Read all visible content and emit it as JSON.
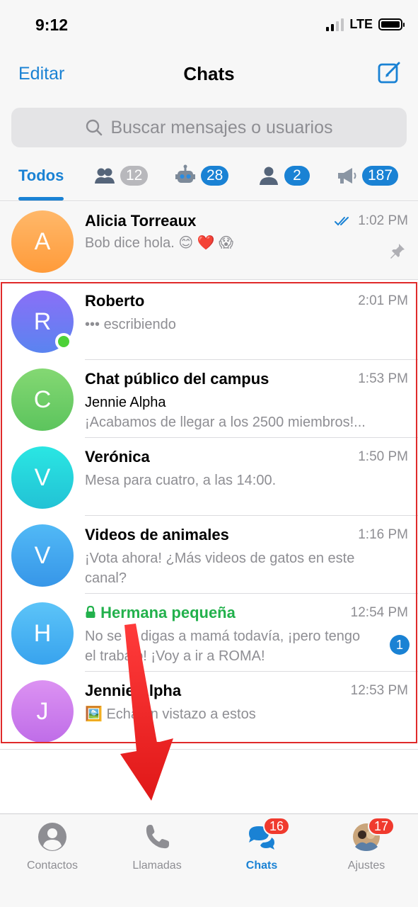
{
  "status_bar": {
    "time": "9:12",
    "network": "LTE"
  },
  "nav": {
    "edit_label": "Editar",
    "title": "Chats"
  },
  "search": {
    "placeholder": "Buscar mensajes o usuarios"
  },
  "tabs": [
    {
      "label": "Todos",
      "icon": "none",
      "active": true
    },
    {
      "icon": "groups-icon",
      "count": "12",
      "badge_style": "grey"
    },
    {
      "icon": "bot-icon",
      "count": "28",
      "badge_style": "blue"
    },
    {
      "icon": "person-icon",
      "count": "2",
      "badge_style": "blue"
    },
    {
      "icon": "megaphone-icon",
      "count": "187",
      "badge_style": "blue"
    }
  ],
  "chats": [
    {
      "initial": "A",
      "name": "Alicia Torreaux",
      "time": "1:02 PM",
      "preview": "Bob dice hola. 😊 ❤️ 😱",
      "pinned": true,
      "read": true,
      "color_from": "#ffb35c",
      "color_to": "#ff9f3e"
    },
    {
      "initial": "R",
      "name": "Roberto",
      "time": "2:01 PM",
      "preview": "••• escribiendo",
      "online": true,
      "color_from": "#7b6cf6",
      "color_to": "#5e7ef0"
    },
    {
      "initial": "C",
      "name": "Chat público del campus",
      "time": "1:53 PM",
      "sender": "Jennie Alpha",
      "preview": "¡Acabamos de llegar a los 2500 miembros!...",
      "color_from": "#7ad46c",
      "color_to": "#58c25a"
    },
    {
      "initial": "V",
      "name": "Verónica",
      "time": "1:50 PM",
      "preview": "Mesa para cuatro, a las 14:00.",
      "color_from": "#2fe0e0",
      "color_to": "#23c3d6"
    },
    {
      "initial": "V",
      "name": "Videos de animales",
      "time": "1:16 PM",
      "preview": "¡Vota ahora! ¿Más videos de gatos en este canal?",
      "color_from": "#4bb4f5",
      "color_to": "#3a98ea"
    },
    {
      "initial": "H",
      "name": "Hermana pequeña",
      "time": "12:54 PM",
      "preview": "No se lo digas a mamá todavía, ¡pero tengo el trabajo! ¡Voy a ir a ROMA!",
      "secret": true,
      "unread": "1",
      "color_from": "#56c0f7",
      "color_to": "#3aa6ef"
    },
    {
      "initial": "J",
      "name": "Jennie Alpha",
      "time": "12:53 PM",
      "preview": "🖼️ Echa un vistazo a estos",
      "color_from": "#d58cf0",
      "color_to": "#c06ee8"
    }
  ],
  "tabbar": [
    {
      "label": "Contactos",
      "icon": "contacts-icon",
      "active": false
    },
    {
      "label": "Llamadas",
      "icon": "phone-icon",
      "active": false
    },
    {
      "label": "Chats",
      "icon": "chats-icon",
      "active": true,
      "badge": "16"
    },
    {
      "label": "Ajustes",
      "icon": "settings-avatar-icon",
      "active": false,
      "badge": "17"
    }
  ],
  "colors": {
    "accent": "#1a82d4",
    "online": "#4cd137",
    "secret": "#22b14c",
    "badge": "#f03a2e",
    "highlight": "#e02a2a"
  }
}
